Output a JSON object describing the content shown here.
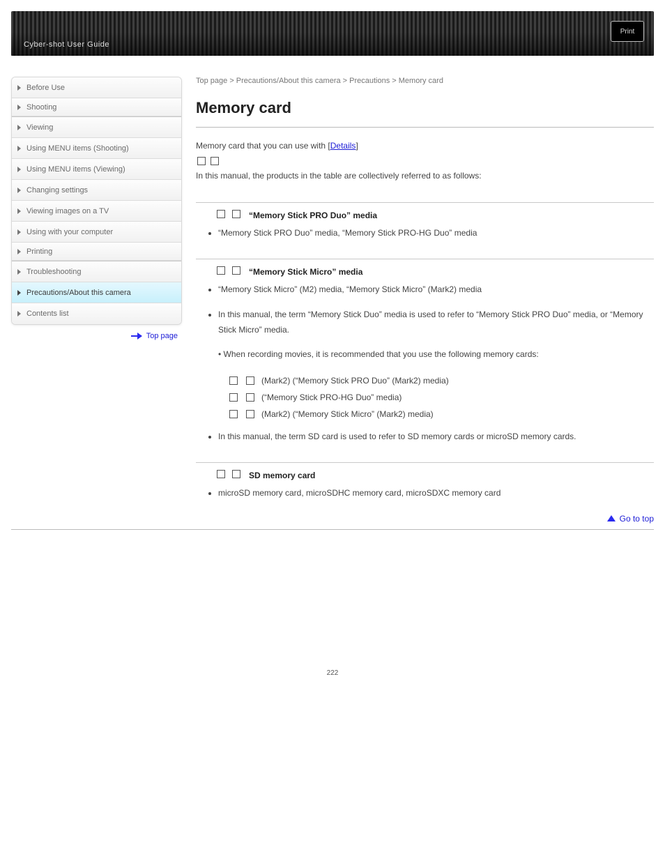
{
  "header": {
    "title": "Cyber-shot User Guide",
    "print_label": "Print"
  },
  "sidebar": {
    "items": [
      {
        "label": "Before Use"
      },
      {
        "label": "Shooting"
      },
      {
        "label": "Viewing"
      },
      {
        "label": "Using MENU items (Shooting)"
      },
      {
        "label": "Using MENU items (Viewing)"
      },
      {
        "label": "Changing settings"
      },
      {
        "label": "Viewing images on a TV"
      },
      {
        "label": "Using with your computer"
      },
      {
        "label": "Printing"
      },
      {
        "label": "Troubleshooting"
      },
      {
        "label": "Precautions/About this camera"
      },
      {
        "label": "Contents list"
      }
    ],
    "active_index": 10,
    "top_link": "Top page"
  },
  "breadcrumb": "Top page > Precautions/About this camera > Precautions > Memory card",
  "page_title": "Memory card",
  "intro": {
    "line1_prefix": "Memory card that you can use with [",
    "line1_link": "Details",
    "line1_suffix": "]",
    "line2": "In this manual, the products in the table are collectively referred to as follows:"
  },
  "sections": [
    {
      "menu": "“Memory Stick PRO Duo” media",
      "notes": [
        "“Memory Stick PRO Duo” media, “Memory Stick PRO-HG Duo” media"
      ]
    },
    {
      "menu": "“Memory Stick Micro” media",
      "notes": [
        "“Memory Stick Micro” (M2) media, “Memory Stick Micro” (Mark2) media",
        "In this manual, the term “Memory Stick Duo” media is used to refer to “Memory Stick PRO Duo” media, or “Memory Stick Micro” media.",
        "• When recording movies, it is recommended that you use the following memory cards:"
      ],
      "sub_links": [
        "(Mark2) (“Memory Stick PRO Duo” (Mark2) media)",
        "(“Memory Stick PRO-HG Duo” media)",
        "(Mark2) (“Memory Stick Micro” (Mark2) media)"
      ],
      "inner_note": "In this manual, the term SD card is used to refer to SD memory cards or microSD memory cards."
    },
    {
      "menu": "SD memory card",
      "notes": [
        "microSD memory card, microSDHC memory card, microSDXC memory card"
      ]
    }
  ],
  "go_top": "Go to top",
  "page_number": "222"
}
